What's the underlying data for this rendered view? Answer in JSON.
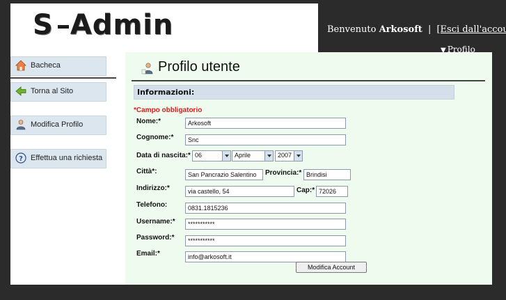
{
  "header": {
    "logo_text": "S-Admin",
    "logo_left": "S",
    "logo_right": "Admin",
    "welcome_text": "Benvenuto",
    "username": "Arkosoft",
    "separator": "|",
    "logout_link": "[Esci dall'account]",
    "profile_menu": "Profilo"
  },
  "sidebar": {
    "items": [
      {
        "label": "Bacheca",
        "icon": "home-icon"
      },
      {
        "label": "Torna al Sito",
        "icon": "arrow-left-icon"
      },
      {
        "label": "Modifica Profilo",
        "icon": "user-icon"
      },
      {
        "label": "Effettua una richiesta",
        "icon": "help-icon"
      }
    ]
  },
  "page": {
    "title": "Profilo utente",
    "section_title": "Informazioni:",
    "required_note": "*Campo obbligatorio"
  },
  "form": {
    "nome_label": "Nome:*",
    "nome_value": "Arkosoft",
    "cognome_label": "Cognome:*",
    "cognome_value": "Snc",
    "nascita_label": "Data di nascita:*",
    "nascita_day": "06",
    "nascita_month": "Aprile",
    "nascita_year": "2007",
    "citta_label": "Città*:",
    "citta_value": "San Pancrazio Salentino",
    "provincia_label": "Provincia:*",
    "provincia_value": "Brindisi",
    "indirizzo_label": "Indirizzo:*",
    "indirizzo_value": "via castello, 54",
    "cap_label": "Cap:*",
    "cap_value": "72026",
    "telefono_label": "Telefono:",
    "telefono_value": "0831.1815236",
    "username_label": "Username:*",
    "username_value": "***********",
    "password_label": "Password:*",
    "password_value": "***********",
    "email_label": "Email:*",
    "email_value": "info@arkosoft.it",
    "submit_label": "Modifica Account"
  },
  "colors": {
    "content_bg": "#f0fbef",
    "menu_item_bg": "#dce6ef",
    "required": "#e01a1a",
    "topbar_bg": "#2b2b2b"
  }
}
